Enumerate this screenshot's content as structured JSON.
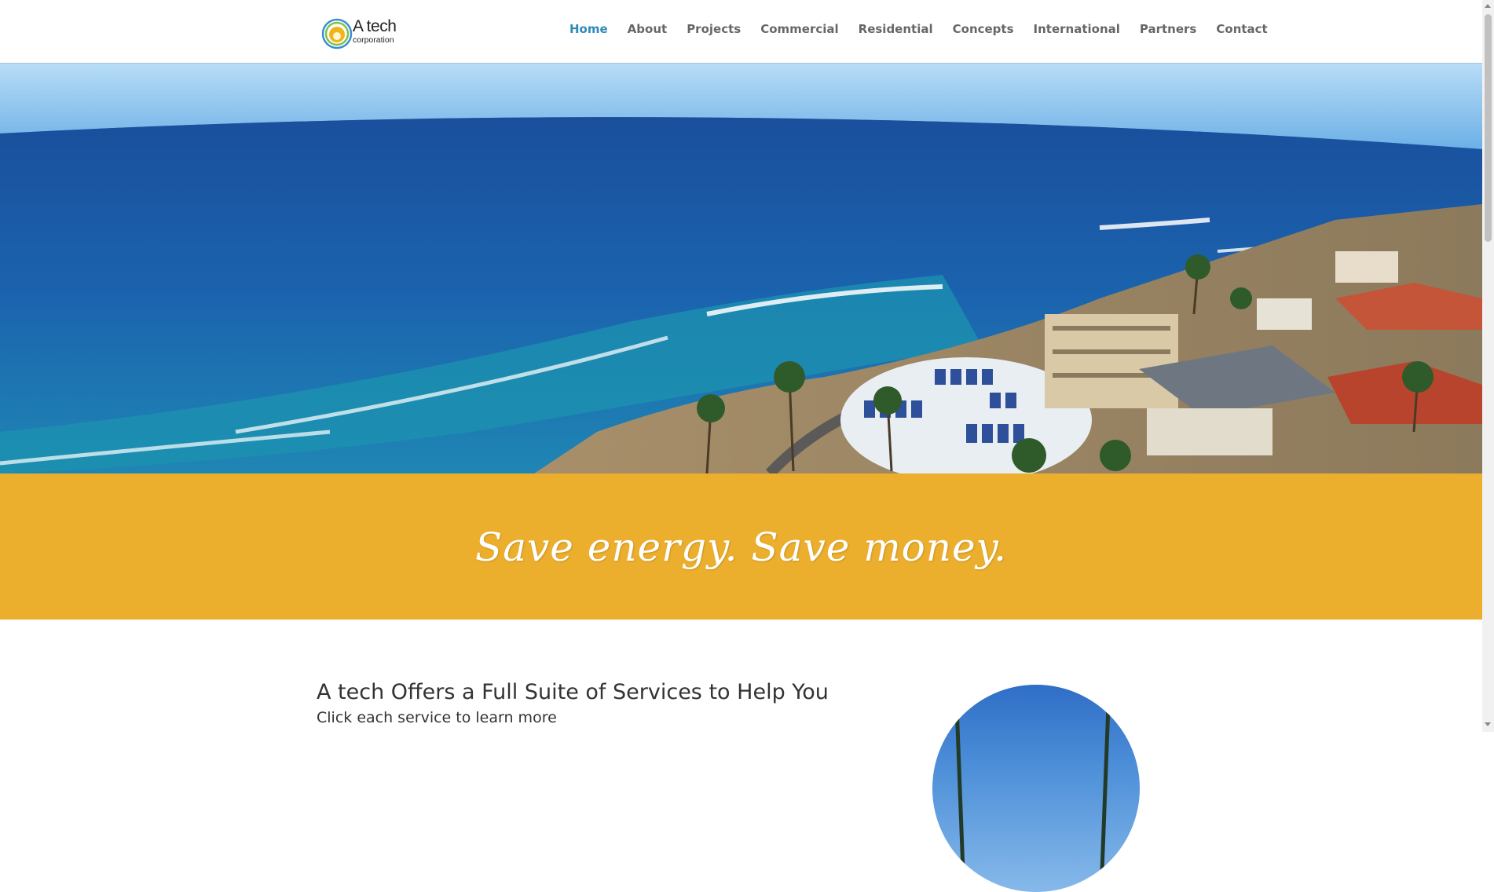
{
  "header": {
    "logo": {
      "title": "A tech",
      "subtitle": "corporation"
    },
    "nav": [
      {
        "label": "Home",
        "active": true
      },
      {
        "label": "About",
        "active": false
      },
      {
        "label": "Projects",
        "active": false
      },
      {
        "label": "Commercial",
        "active": false
      },
      {
        "label": "Residential",
        "active": false
      },
      {
        "label": "Concepts",
        "active": false
      },
      {
        "label": "International",
        "active": false
      },
      {
        "label": "Partners",
        "active": false
      },
      {
        "label": "Contact",
        "active": false
      }
    ]
  },
  "hero": {
    "image": "aerial-coastline-solar-rooftops"
  },
  "banner": {
    "tagline": "Save energy. Save money.",
    "background": "#ecae2d"
  },
  "services": {
    "title": "A tech Offers a Full Suite of Services to Help You",
    "subtitle": "Click each service to learn more"
  },
  "colors": {
    "accent": "#2e8ab8",
    "banner": "#ecae2d",
    "nav_text": "#666666"
  }
}
